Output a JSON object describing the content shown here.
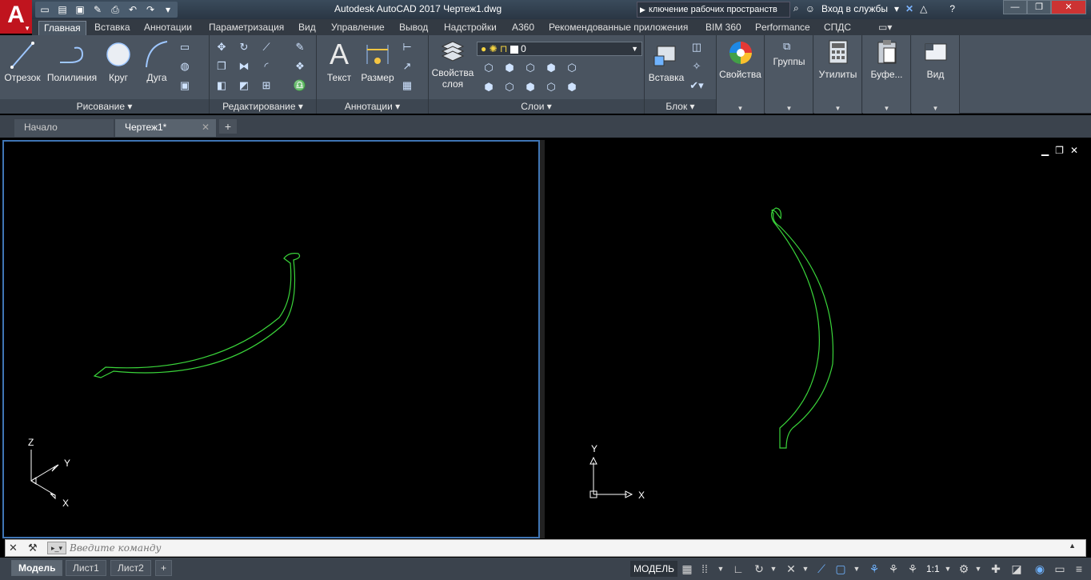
{
  "titlebar": {
    "title": "Autodesk AutoCAD 2017    Чертеж1.dwg",
    "workspace": "ключение рабочих пространств",
    "signin": "Вход в службы",
    "colors": {
      "titlebar": "#2f3c4a",
      "logo": "#c0141e"
    }
  },
  "ribbon_tabs": [
    "Главная",
    "Вставка",
    "Аннотации",
    "Параметризация",
    "Вид",
    "Управление",
    "Вывод",
    "Надстройки",
    "A360",
    "Рекомендованные приложения",
    "BIM 360",
    "Performance",
    "СПДС"
  ],
  "panels": {
    "draw": {
      "title": "Рисование",
      "line": "Отрезок",
      "polyline": "Полилиния",
      "circle": "Круг",
      "arc": "Дуга"
    },
    "modify": {
      "title": "Редактирование"
    },
    "annotation": {
      "title": "Аннотации",
      "text": "Текст",
      "dimension": "Размер"
    },
    "layers": {
      "title": "Слои",
      "props_line1": "Свойства",
      "props_line2": "слоя",
      "current_layer": "0"
    },
    "block": {
      "title": "Блок",
      "insert": "Вставка"
    },
    "properties": "Свойства",
    "groups": "Группы",
    "utilities": "Утилиты",
    "clipboard": "Буфе...",
    "view": "Вид"
  },
  "doc_tabs": {
    "start": "Начало",
    "drawing": "Чертеж1*"
  },
  "viewports": {
    "left": {
      "ucs_z": "Z",
      "ucs_y": "Y",
      "ucs_x": "X"
    },
    "right": {
      "ucs_y": "Y",
      "ucs_x": "X"
    },
    "curve_color": "#3ad43a"
  },
  "command": {
    "placeholder": "Введите команду"
  },
  "status": {
    "model": "Модель",
    "layout1": "Лист1",
    "layout2": "Лист2",
    "space": "МОДЕЛЬ",
    "scale": "1:1"
  }
}
